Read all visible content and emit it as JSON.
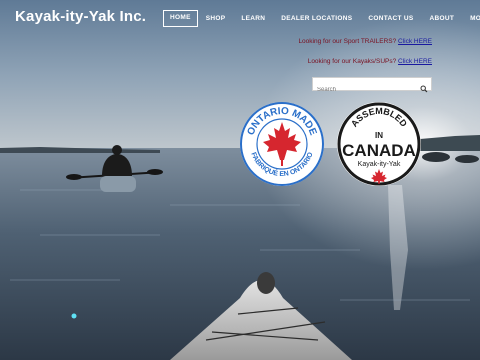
{
  "site": {
    "title": "Kayak-ity-Yak Inc."
  },
  "nav": [
    {
      "label": "HOME",
      "active": true
    },
    {
      "label": "SHOP"
    },
    {
      "label": "LEARN"
    },
    {
      "label": "DEALER LOCATIONS"
    },
    {
      "label": "CONTACT US"
    },
    {
      "label": "ABOUT"
    },
    {
      "label": "MORE..."
    }
  ],
  "promos": [
    {
      "text": "Looking for our Sport TRAILERS?",
      "link": "Click HERE"
    },
    {
      "text": "Looking for our Kayaks/SUPs?",
      "link": "Click HERE"
    }
  ],
  "search": {
    "placeholder": "Search"
  },
  "badges": {
    "ontario": {
      "top": "ONTARIO MADE",
      "bottom": "FABRIQUÉ EN ONTARIO"
    },
    "canada": {
      "line1": "ASSEMBLED",
      "line2": "IN",
      "line3": "CANADA",
      "line4": "Kayak-ity-Yak"
    }
  },
  "colors": {
    "promo_text": "#7a1020",
    "link": "#1a1aa0",
    "ontario_blue": "#2a6fc9",
    "maple_red": "#d6262f"
  }
}
